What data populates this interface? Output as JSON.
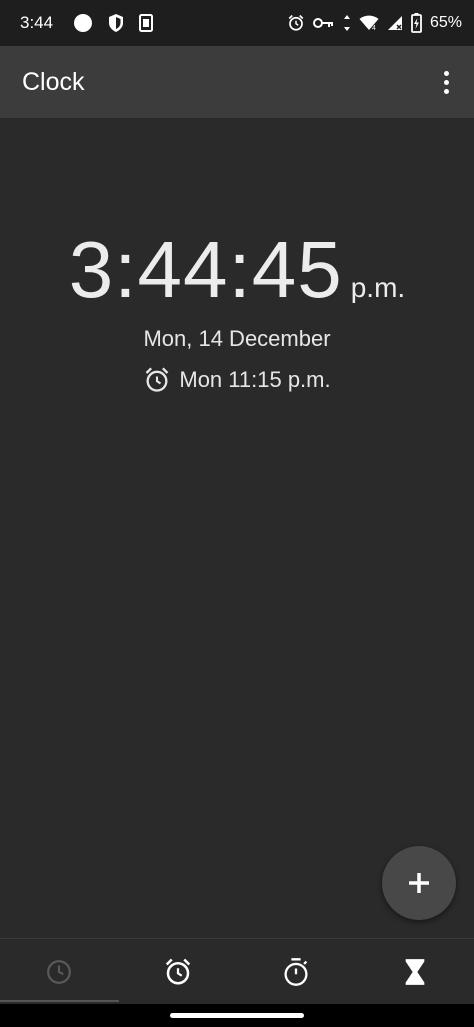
{
  "status_bar": {
    "time": "3:44",
    "battery_percent": "65%",
    "left_icons": [
      "circle-icon",
      "shield-icon",
      "sim-icon"
    ],
    "right_icons": [
      "alarm-icon",
      "vpn-key-icon",
      "data-arrows-icon",
      "wifi-icon",
      "signal-icon",
      "battery-charging-icon"
    ]
  },
  "app_bar": {
    "title": "Clock",
    "overflow_icon": "more-vert-icon"
  },
  "clock": {
    "time": "3:44:45",
    "ampm": "p.m.",
    "date": "Mon, 14 December",
    "next_alarm": "Mon 11:15 p.m."
  },
  "fab": {
    "icon": "plus-icon"
  },
  "bottom_nav": {
    "tabs": [
      {
        "icon": "clock-icon",
        "active": true
      },
      {
        "icon": "alarm-icon",
        "active": false
      },
      {
        "icon": "stopwatch-icon",
        "active": false
      },
      {
        "icon": "hourglass-icon",
        "active": false
      }
    ]
  },
  "colors": {
    "background": "#2a2a2a",
    "app_bar": "#3c3c3c",
    "status_bar": "#1e1e1e",
    "fab": "#484848",
    "text": "#ececec",
    "inactive_tab_icon": "#5a5a5a"
  }
}
